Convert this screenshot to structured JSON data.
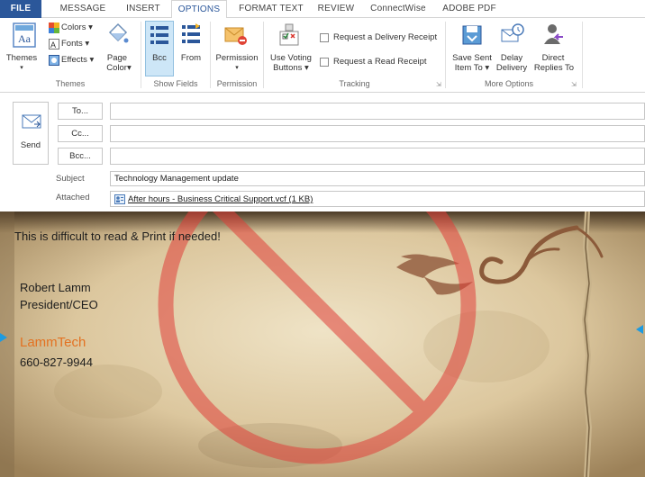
{
  "tabs": {
    "file": "FILE",
    "message": "MESSAGE",
    "insert": "INSERT",
    "options": "OPTIONS",
    "format_text": "FORMAT TEXT",
    "review": "REVIEW",
    "connectwise": "ConnectWise",
    "adobe_pdf": "ADOBE PDF"
  },
  "ribbon": {
    "themes": {
      "themes_label": "Themes",
      "colors_label": "Colors",
      "fonts_label": "Fonts",
      "effects_label": "Effects",
      "page_color_line1": "Page",
      "page_color_line2": "Color",
      "group_label": "Themes"
    },
    "show_fields": {
      "bcc_label": "Bcc",
      "from_label": "From",
      "group_label": "Show Fields"
    },
    "permission": {
      "permission_label": "Permission",
      "group_label": "Permission"
    },
    "tracking": {
      "use_voting_line1": "Use Voting",
      "use_voting_line2": "Buttons",
      "delivery_receipt": "Request a Delivery Receipt",
      "read_receipt": "Request a Read Receipt",
      "group_label": "Tracking"
    },
    "more_options": {
      "save_sent_line1": "Save Sent",
      "save_sent_line2": "Item To",
      "delay_line1": "Delay",
      "delay_line2": "Delivery",
      "direct_line1": "Direct",
      "direct_line2": "Replies To",
      "group_label": "More Options"
    }
  },
  "compose": {
    "send_label": "Send",
    "to_label": "To...",
    "cc_label": "Cc...",
    "bcc_label": "Bcc...",
    "subject_label": "Subject",
    "subject_value": "Technology Management update",
    "attached_label": "Attached",
    "attachment_name": "After hours - Business Critical Support.vcf (1 KB)"
  },
  "body": {
    "line1": "This is difficult to read & Print if needed!",
    "name": "Robert Lamm",
    "title": "President/CEO",
    "company": "LammTech",
    "phone": "660-827-9944"
  },
  "colors": {
    "accent": "#2b579a",
    "tab_active": "#2b579a",
    "company_orange": "#e37222",
    "no_symbol_red": "#e0403a",
    "arrow_blue": "#1e9be0"
  }
}
